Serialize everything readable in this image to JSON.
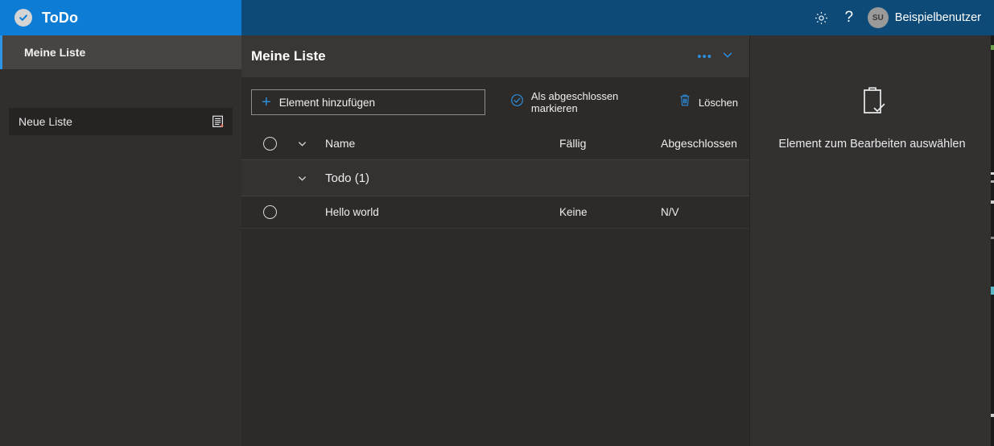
{
  "header": {
    "brand_title": "ToDo",
    "brand_logo_icon": "check-circle-icon",
    "settings_icon": "gear-icon",
    "help_icon": "question-mark-icon",
    "avatar_initials": "SU",
    "user_name": "Beispielbenutzer",
    "brand_color": "#0c7cd5",
    "bar_color": "#0d4a77"
  },
  "sidebar": {
    "items": [
      {
        "label": "Meine Liste",
        "selected": true,
        "accent_color": "#2b95e9"
      }
    ],
    "new_list": {
      "value": "Neue Liste",
      "placeholder": "Neue Liste",
      "icon": "list-add-icon"
    }
  },
  "list_panel": {
    "title": "Meine Liste",
    "overflow_icon": "ellipsis-icon",
    "collapse_icon": "chevron-down-icon",
    "toolbar": {
      "add_item_label": "Element hinzufügen",
      "add_item_icon": "plus-icon",
      "complete_label": "Als abgeschlossen markieren",
      "complete_icon": "check-circle-icon",
      "delete_label": "Löschen",
      "delete_icon": "trash-icon",
      "accent_color": "#2b8fe0"
    },
    "table": {
      "columns": [
        "Name",
        "Fällig",
        "Abgeschlossen"
      ],
      "select_all_icon": "checkbox-circle-icon",
      "expand_icon": "chevron-down-icon",
      "groups": [
        {
          "label": "Todo (1)",
          "expand_icon": "chevron-down-icon",
          "rows": [
            {
              "check_icon": "checkbox-circle-icon",
              "name": "Hello world",
              "due": "Keine",
              "completed": "N/V"
            }
          ]
        }
      ]
    }
  },
  "detail_panel": {
    "empty_icon": "clipboard-check-icon",
    "empty_text": "Element zum Bearbeiten auswählen"
  }
}
